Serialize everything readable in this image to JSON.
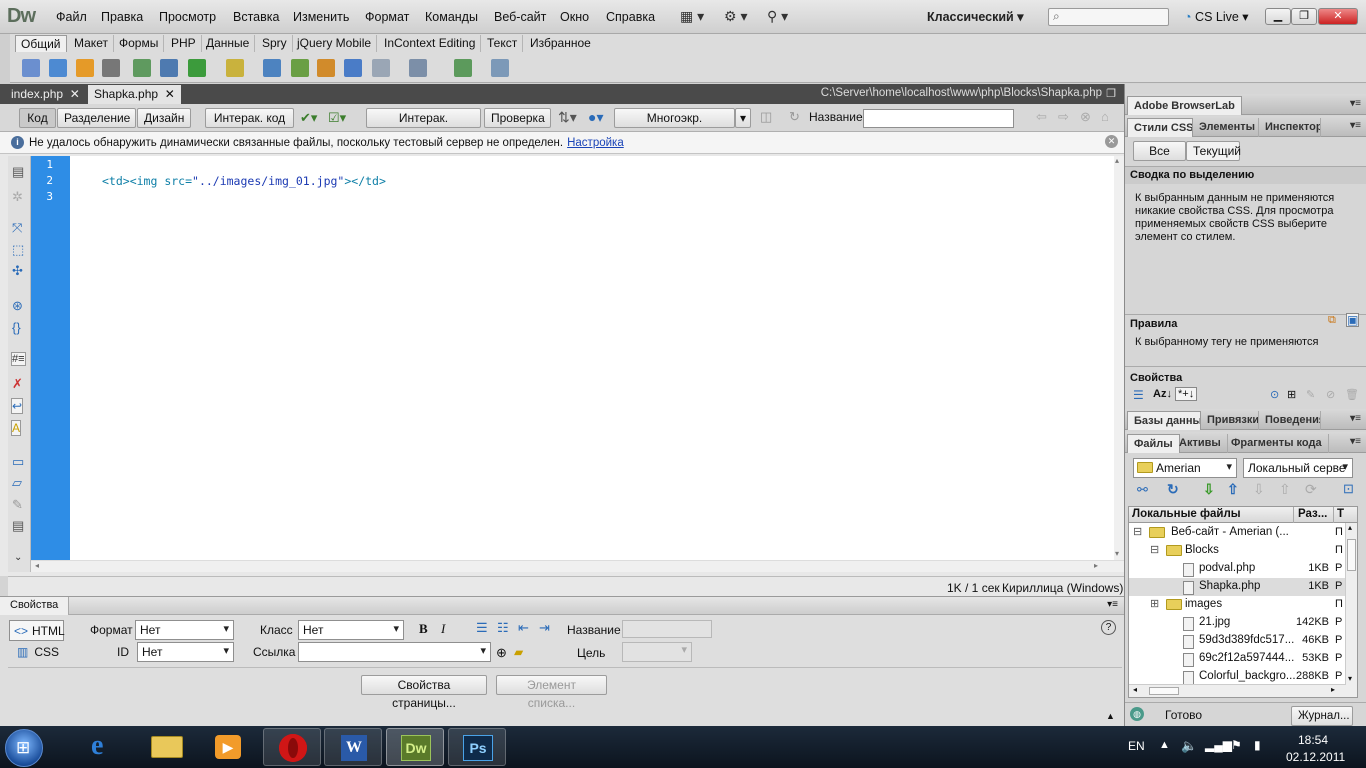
{
  "app": {
    "logo": "Dw"
  },
  "menu": [
    "Файл",
    "Правка",
    "Просмотр",
    "Вставка",
    "Изменить",
    "Формат",
    "Команды",
    "Веб-сайт",
    "Окно",
    "Справка"
  ],
  "workspace": "Классический",
  "cslive": "CS Live",
  "insert_tabs": [
    "Общий",
    "Макет",
    "Формы",
    "PHP",
    "Данные",
    "Spry",
    "jQuery Mobile",
    "InContext Editing",
    "Текст",
    "Избранное"
  ],
  "doc_tabs": [
    "index.php",
    "Shapka.php"
  ],
  "doc_path": "C:\\Server\\home\\localhost\\www\\php\\Blocks\\Shapka.php",
  "doc_toolbar": {
    "code": "Код",
    "split": "Разделение",
    "design": "Дизайн",
    "live_code": "Интерак. код",
    "live_view": "Интерак. просмотр",
    "inspect": "Проверка",
    "multiscreen": "Многоэкр. просмотр",
    "title_label": "Название:"
  },
  "info_bar": {
    "message": "Не удалось обнаружить динамически связанные файлы, поскольку тестовый сервер не определен.",
    "link": "Настройка"
  },
  "editor": {
    "line_numbers": [
      "1",
      "2",
      "3"
    ],
    "line2_open": "<td>",
    "line2_img": "<img src=",
    "line2_src": "\"../images/img_01.jpg\"",
    "line2_close": "></td>"
  },
  "status": {
    "size_time": "1K / 1 сек",
    "encoding": "Кириллица (Windows)"
  },
  "properties": {
    "title": "Свойства",
    "html_btn": "HTML",
    "css_btn": "CSS",
    "format_label": "Формат",
    "format_value": "Нет",
    "id_label": "ID",
    "id_value": "Нет",
    "class_label": "Класс",
    "class_value": "Нет",
    "link_label": "Ссылка",
    "name_label": "Название",
    "target_label": "Цель",
    "page_props": "Свойства страницы...",
    "list_item": "Элемент списка..."
  },
  "right": {
    "browserlab": "Adobe BrowserLab",
    "css_tabs": [
      "Стили CSS",
      "Элементы А",
      "Инспектор т"
    ],
    "all_btn": "Все",
    "current_btn": "Текущий",
    "summary_title": "Сводка по выделению",
    "summary_text": "К выбранным данным не применяются никакие свойства CSS.  Для просмотра применяемых свойств CSS выберите элемент со стилем.",
    "rules_title": "Правила",
    "rules_text": "К выбранному тегу не применяются",
    "props_title": "Свойства",
    "db_tabs": [
      "Базы данных",
      "Привязки",
      "Поведения"
    ],
    "files_tabs": [
      "Файлы",
      "Активы",
      "Фрагменты кода"
    ],
    "site_select": "Amerian",
    "view_select": "Локальный серве",
    "local_files": "Локальные файлы",
    "size_col": "Раз...",
    "type_col": "Т",
    "files": [
      {
        "name": "Веб-сайт - Amerian (...",
        "size": "",
        "type": "П",
        "indent": 1,
        "kind": "folder",
        "sign": "⊟"
      },
      {
        "name": "Blocks",
        "size": "",
        "type": "П",
        "indent": 2,
        "kind": "folder",
        "sign": "⊟"
      },
      {
        "name": "podval.php",
        "size": "1KB",
        "type": "P",
        "indent": 3,
        "kind": "file",
        "sign": ""
      },
      {
        "name": "Shapka.php",
        "size": "1KB",
        "type": "P",
        "indent": 3,
        "kind": "file",
        "sign": ""
      },
      {
        "name": "images",
        "size": "",
        "type": "П",
        "indent": 2,
        "kind": "folder",
        "sign": "⊞"
      },
      {
        "name": "21.jpg",
        "size": "142KB",
        "type": "Р",
        "indent": 3,
        "kind": "file",
        "sign": ""
      },
      {
        "name": "59d3d389fdc517...",
        "size": "46KB",
        "type": "Р",
        "indent": 3,
        "kind": "file",
        "sign": ""
      },
      {
        "name": "69c2f12a597444...",
        "size": "53KB",
        "type": "Р",
        "indent": 3,
        "kind": "file",
        "sign": ""
      },
      {
        "name": "Colorful_backgro...",
        "size": "288KB",
        "type": "Р",
        "indent": 3,
        "kind": "file",
        "sign": ""
      }
    ],
    "ready": "Готово",
    "log_btn": "Журнал..."
  },
  "taskbar": {
    "lang": "EN",
    "time": "18:54",
    "date": "02.12.2011"
  },
  "colors": {
    "accent_blue": "#2e8de6",
    "code_tag": "#0e7fa7",
    "code_string": "#1d3bb3"
  }
}
